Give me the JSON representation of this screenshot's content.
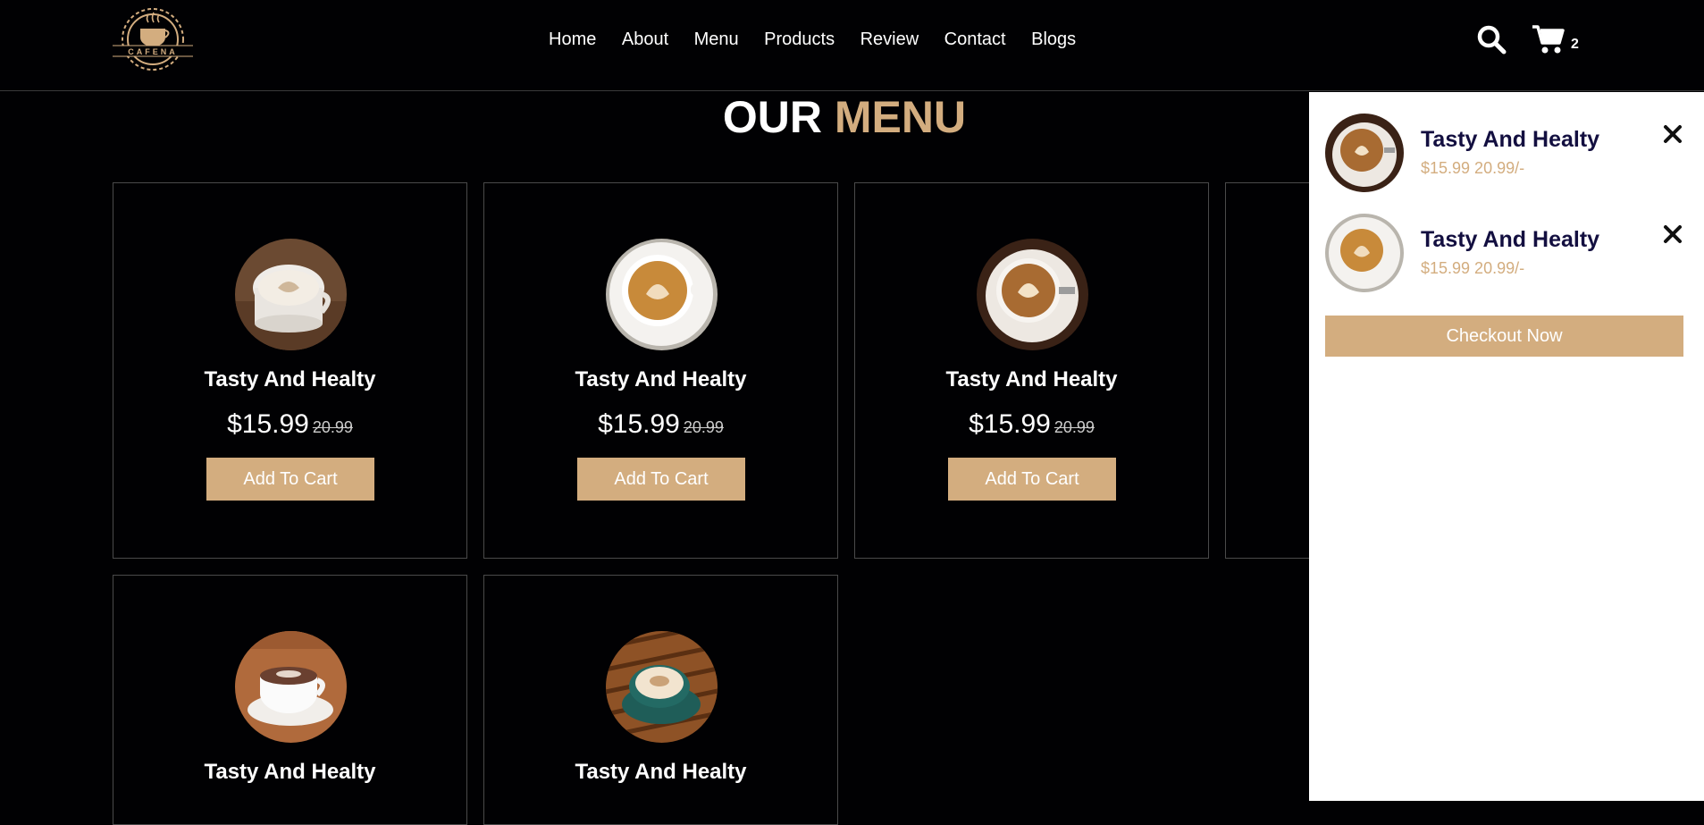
{
  "brand": {
    "logo_text": "CAFENA"
  },
  "nav": [
    {
      "label": "Home"
    },
    {
      "label": "About"
    },
    {
      "label": "Menu"
    },
    {
      "label": "Products"
    },
    {
      "label": "Review"
    },
    {
      "label": "Contact"
    },
    {
      "label": "Blogs"
    }
  ],
  "header_icons": {
    "search": "search-icon",
    "cart": "shopping-cart-icon",
    "cart_count": "2"
  },
  "section": {
    "title_main": "OUR",
    "title_accent": "MENU"
  },
  "menu_items": [
    {
      "name": "Tasty And Healty",
      "price": "$15.99",
      "old_price": "20.99",
      "button": "Add To Cart"
    },
    {
      "name": "Tasty And Healty",
      "price": "$15.99",
      "old_price": "20.99",
      "button": "Add To Cart"
    },
    {
      "name": "Tasty And Healty",
      "price": "$15.99",
      "old_price": "20.99",
      "button": "Add To Cart"
    },
    {
      "name": "Tasty And Healty"
    },
    {
      "name": "Tasty And Healty"
    }
  ],
  "cart": {
    "items": [
      {
        "title": "Tasty And Healty",
        "price": "$15.99 20.99/-"
      },
      {
        "title": "Tasty And Healty",
        "price": "$15.99 20.99/-"
      }
    ],
    "checkout_label": "Checkout Now"
  },
  "colors": {
    "accent": "#d3ad7f",
    "background": "#010103",
    "panel": "#ffffff"
  }
}
